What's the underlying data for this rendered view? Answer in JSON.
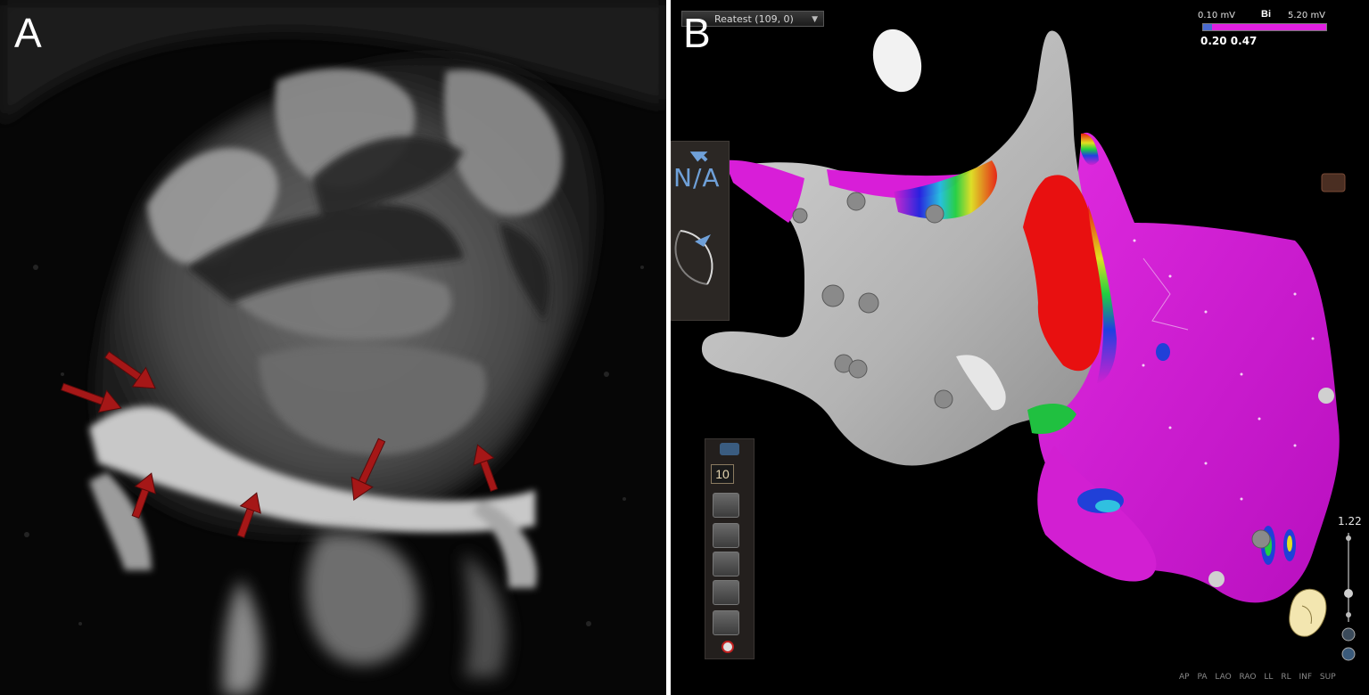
{
  "figure": {
    "panel_a": {
      "letter": "A"
    },
    "panel_b": {
      "letter": "B"
    }
  },
  "map_view": {
    "map_selector": "Reatest (109, 0)",
    "voltage_scale": {
      "type": "Bi",
      "min_label": "0.10 mV",
      "max_label": "5.20 mV",
      "thresholds_label": "0.20 0.47"
    },
    "orientation_label": "N/A",
    "point_size_value": "10",
    "zoom_value": "1.22",
    "view_buttons": [
      "AP",
      "PA",
      "LAO",
      "RAO",
      "LL",
      "RL",
      "INF",
      "SUP"
    ]
  },
  "colors": {
    "low_voltage": "#e81010",
    "normal_voltage": "#d81ed8",
    "grey_mesh": "#bdbdbd",
    "arrow": "#b01818"
  }
}
